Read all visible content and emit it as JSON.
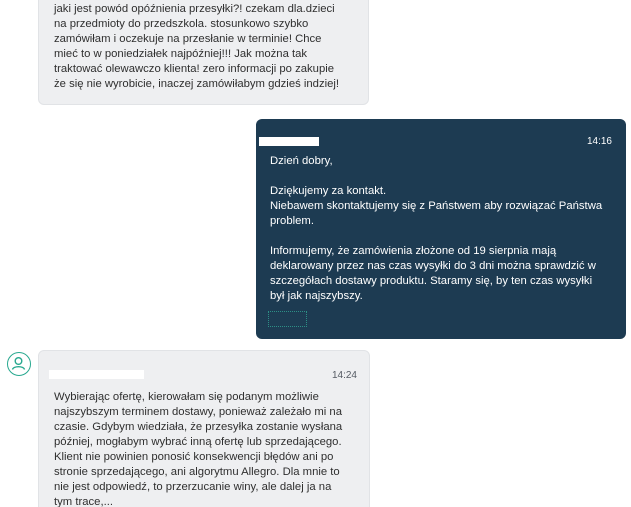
{
  "messages": [
    {
      "sender": "buyer",
      "text": "jaki jest powód opóźnienia przesyłki?! czekam dla.dzieci\nna przedmioty do przedszkola. stosunkowo szybko\nzamówiłam i oczekuje na przesłanie w terminie! Chce\nmieć to w poniedziałek najpóźniej!!! Jak można tak\ntraktować olewawczo klienta! zero informacji po zakupie\nże się nie wyrobicie, inaczej zamówiłabym gdzieś indziej!"
    },
    {
      "sender": "seller",
      "time": "14:16",
      "text": "Dzień dobry,\n\nDziękujemy za kontakt.\nNiebawem skontaktujemy się z Państwem aby rozwiązać Państwa\nproblem.\n\nInformujemy, że zamówienia złożone od 19 sierpnia mają\ndeklarowany przez nas czas wysyłki do 3 dni można sprawdzić w\nszczegółach dostawy produktu. Staramy się, by ten czas wysyłki\nbył jak najszybszy."
    },
    {
      "sender": "buyer",
      "time": "14:24",
      "text": "Wybierając ofertę, kierowałam się podanym możliwie\nnajszybszym terminem dostawy, ponieważ zależało mi na\nczasie. Gdybym wiedziała, że przesyłka zostanie wysłana\npóźniej, mogłabym wybrać inną ofertę lub sprzedającego.\nKlient nie powinien ponosić konsekwencji błędów ani po\nstronie sprzedającego, ani algorytmu Allegro. Dla mnie to\nnie jest odpowiedź, to przerzucanie winy, ale dalej ja na\ntym trace,..."
    }
  ],
  "colors": {
    "buyer_bubble": "#eeeff1",
    "seller_bubble": "#1d3b52",
    "avatar_accent": "#27a88f"
  },
  "icons": {
    "avatar": "user-circle-icon"
  }
}
